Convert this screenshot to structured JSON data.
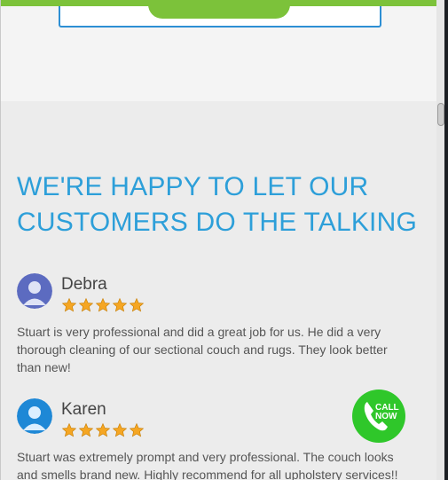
{
  "heading_line1": "WE'RE HAPPY TO LET OUR",
  "heading_line2": "CUSTOMERS DO THE TALKING",
  "reviews": [
    {
      "name": "Debra",
      "rating": 5,
      "text": "Stuart is very professional and did a great job for us. He did a very thorough cleaning of our sectional couch and rugs. They look better than new!",
      "avatar_color": "#5c6bc0"
    },
    {
      "name": "Karen",
      "rating": 5,
      "text": "Stuart was extremely prompt and very professional. The couch looks and smells brand new. Highly recommend for all upholstery services!!",
      "avatar_color": "#1e88d6"
    }
  ],
  "call_button": {
    "label_line1": "CALL",
    "label_line2": "NOW",
    "icon": "phone-icon",
    "color": "#2fc72a"
  },
  "colors": {
    "accent_green": "#7cc23a",
    "accent_blue": "#2d9fd9",
    "star": "#f5a623"
  }
}
